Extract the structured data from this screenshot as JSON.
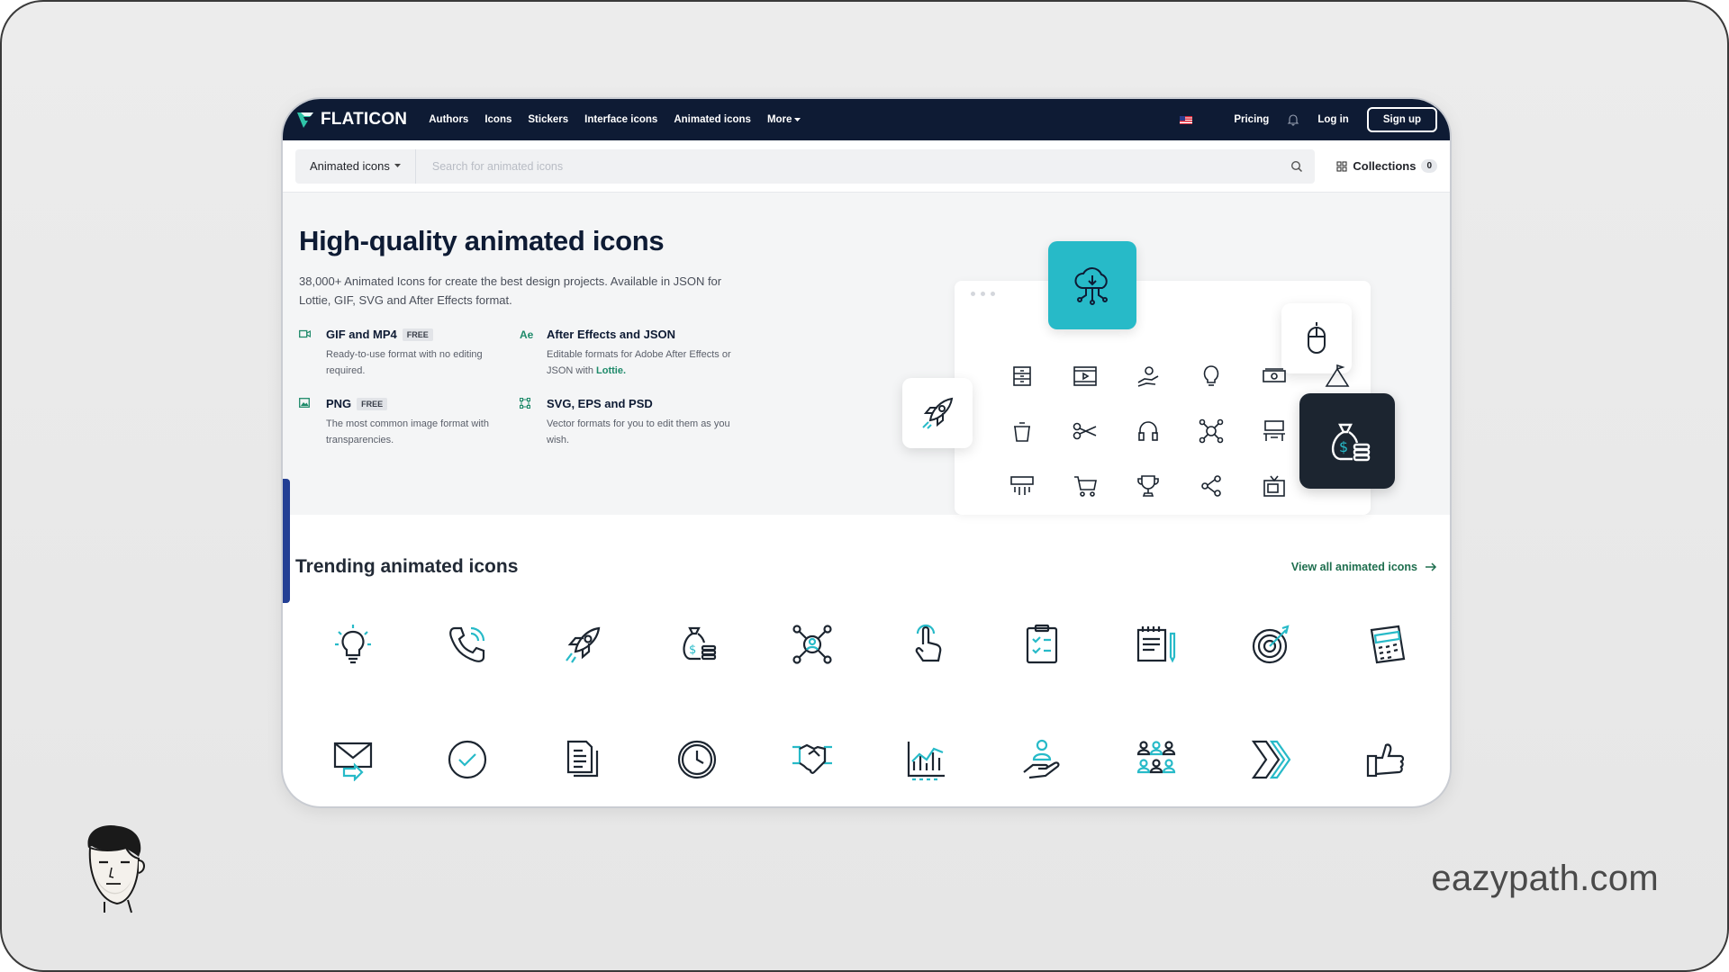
{
  "nav": {
    "brand": "FLATICON",
    "links": [
      "Authors",
      "Icons",
      "Stickers",
      "Interface icons",
      "Animated icons",
      "More"
    ],
    "pricing": "Pricing",
    "login": "Log in",
    "signup": "Sign up"
  },
  "search": {
    "type": "Animated icons",
    "placeholder": "Search for animated icons",
    "collections_label": "Collections",
    "collections_count": "0"
  },
  "hero": {
    "title": "High-quality animated icons",
    "description": "38,000+ Animated Icons for create the best design projects. Available in JSON for Lottie, GIF, SVG and After Effects format.",
    "features": [
      {
        "icon": "video-icon",
        "title": "GIF and MP4",
        "badge": "FREE",
        "desc": "Ready-to-use format with no editing required."
      },
      {
        "icon": "ae-icon",
        "icon_text": "Ae",
        "title": "After Effects and JSON",
        "badge": "",
        "desc": "Editable formats for Adobe After Effects or JSON with",
        "link": "Lottie."
      },
      {
        "icon": "image-icon",
        "title": "PNG",
        "badge": "FREE",
        "desc": "The most common image format with transparencies."
      },
      {
        "icon": "vector-icon",
        "title": "SVG, EPS and PSD",
        "badge": "",
        "desc": "Vector formats for you to edit them as you wish."
      }
    ]
  },
  "trending": {
    "title": "Trending animated icons",
    "view_all": "View all animated icons",
    "icons": [
      "lightbulb-icon",
      "phone-call-icon",
      "rocket-icon",
      "money-bag-icon",
      "network-icon",
      "touch-hand-icon",
      "clipboard-icon",
      "notepad-icon",
      "target-icon",
      "calculator-icon",
      "mail-icon",
      "check-circle-icon",
      "documents-icon",
      "clock-icon",
      "handshake-icon",
      "analytics-chart-icon",
      "user-hand-icon",
      "team-icon",
      "chevrons-right-icon",
      "thumbs-up-icon"
    ]
  },
  "watermark": "eazypath.com",
  "colors": {
    "navy": "#0e1b34",
    "teal": "#27bac8",
    "green": "#1e8a6a",
    "dark_tile": "#1c2530"
  }
}
